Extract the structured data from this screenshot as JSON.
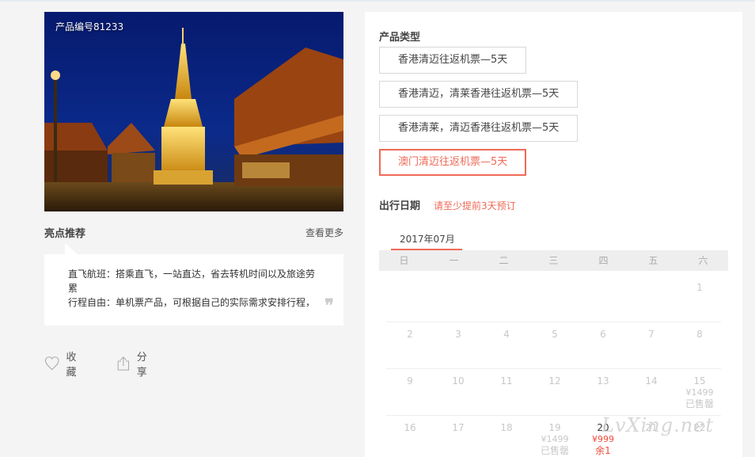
{
  "product": {
    "code_label": "产品编号81233"
  },
  "highlights": {
    "title": "亮点推荐",
    "more_label": "查看更多",
    "lines": [
      "直飞航班：搭乘直飞，一站直达，省去转机时间以及旅途劳累",
      "行程自由：单机票产品，可根据自己的实际需求安排行程，"
    ]
  },
  "actions": {
    "favorite_label": "收藏",
    "share_label": "分享"
  },
  "product_type": {
    "label": "产品类型",
    "options": [
      {
        "label": "香港清迈往返机票—5天",
        "selected": false
      },
      {
        "label": "香港清迈，清莱香港往返机票—5天",
        "selected": false
      },
      {
        "label": "香港清莱，清迈香港往返机票—5天",
        "selected": false
      },
      {
        "label": "澳门清迈往返机票—5天",
        "selected": true
      }
    ]
  },
  "travel_date": {
    "label": "出行日期",
    "note": "请至少提前3天预订",
    "month_tab": "2017年07月",
    "weekdays": [
      "日",
      "一",
      "二",
      "三",
      "四",
      "五",
      "六"
    ],
    "weeks": [
      [
        null,
        null,
        null,
        null,
        null,
        null,
        {
          "day": "1"
        }
      ],
      [
        {
          "day": "2"
        },
        {
          "day": "3"
        },
        {
          "day": "4"
        },
        {
          "day": "5"
        },
        {
          "day": "6"
        },
        {
          "day": "7"
        },
        {
          "day": "8"
        }
      ],
      [
        {
          "day": "9"
        },
        {
          "day": "10"
        },
        {
          "day": "11"
        },
        {
          "day": "12"
        },
        {
          "day": "13"
        },
        {
          "day": "14"
        },
        {
          "day": "15",
          "price": "¥1499",
          "status": "已售罄"
        }
      ],
      [
        {
          "day": "16"
        },
        {
          "day": "17"
        },
        {
          "day": "18"
        },
        {
          "day": "19",
          "price": "¥1499",
          "status": "已售罄"
        },
        {
          "day": "20",
          "price": "¥999",
          "status": "余1",
          "available": true
        },
        {
          "day": "21"
        },
        {
          "day": "22"
        }
      ]
    ]
  },
  "watermark": "LvXing.net",
  "colors": {
    "accent": "#ef6a57",
    "price_red": "#ef4c3c",
    "background": "#f4f4f4"
  },
  "icons": {
    "favorite": "heart-icon",
    "share": "share-icon",
    "quote": "quote-icon"
  }
}
